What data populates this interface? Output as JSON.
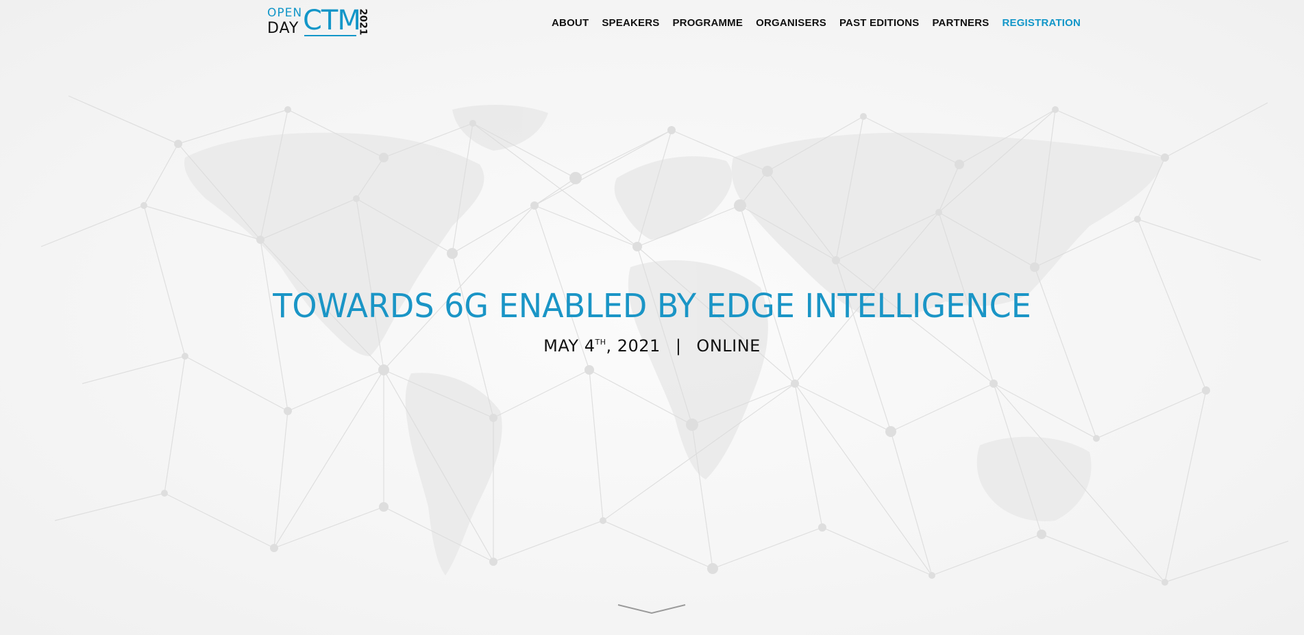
{
  "logo": {
    "open": "OPEN",
    "day": "DAY",
    "ctm": "CTM",
    "year": "2021"
  },
  "nav": {
    "items": [
      {
        "label": "ABOUT"
      },
      {
        "label": "SPEAKERS"
      },
      {
        "label": "PROGRAMME"
      },
      {
        "label": "ORGANISERS"
      },
      {
        "label": "PAST EDITIONS"
      },
      {
        "label": "PARTNERS"
      },
      {
        "label": "REGISTRATION"
      }
    ],
    "active": "REGISTRATION"
  },
  "hero": {
    "title": "TOWARDS 6G ENABLED BY EDGE INTELLIGENCE",
    "date_prefix": "MAY 4",
    "date_suffix": "TH",
    "date_year": ", 2021",
    "separator": "|",
    "location": "ONLINE"
  },
  "colors": {
    "accent": "#1296c8",
    "text": "#111111",
    "background": "#f5f5f5"
  },
  "icons": {
    "scroll": "chevron-down-icon",
    "background": "world-network-map"
  }
}
